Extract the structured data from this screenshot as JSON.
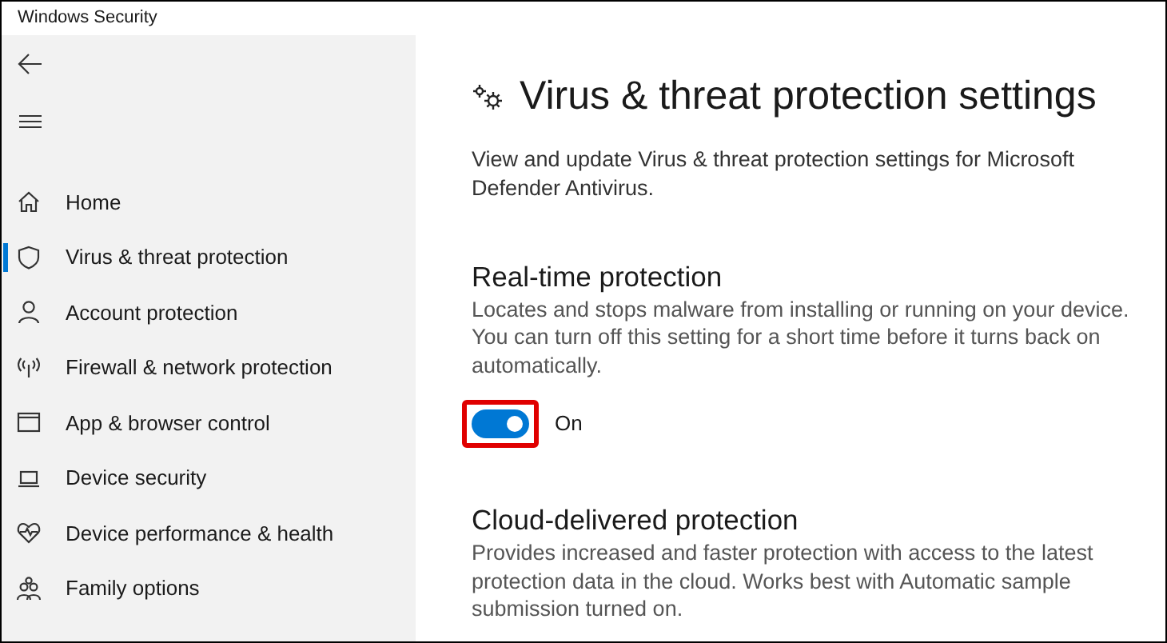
{
  "window": {
    "title": "Windows Security"
  },
  "sidebar": {
    "items": [
      {
        "label": "Home",
        "selected": false
      },
      {
        "label": "Virus & threat protection",
        "selected": true
      },
      {
        "label": "Account protection",
        "selected": false
      },
      {
        "label": "Firewall & network protection",
        "selected": false
      },
      {
        "label": "App & browser control",
        "selected": false
      },
      {
        "label": "Device security",
        "selected": false
      },
      {
        "label": "Device performance & health",
        "selected": false
      },
      {
        "label": "Family options",
        "selected": false
      }
    ]
  },
  "page": {
    "title": "Virus & threat protection settings",
    "description": "View and update Virus & threat protection settings for Microsoft Defender Antivirus."
  },
  "sections": [
    {
      "title": "Real-time protection",
      "description": "Locates and stops malware from installing or running on your device. You can turn off this setting for a short time before it turns back on automatically.",
      "toggle": {
        "on": true,
        "label": "On",
        "highlighted": true
      }
    },
    {
      "title": "Cloud-delivered protection",
      "description": "Provides increased and faster protection with access to the latest protection data in the cloud. Works best with Automatic sample submission turned on."
    }
  ]
}
